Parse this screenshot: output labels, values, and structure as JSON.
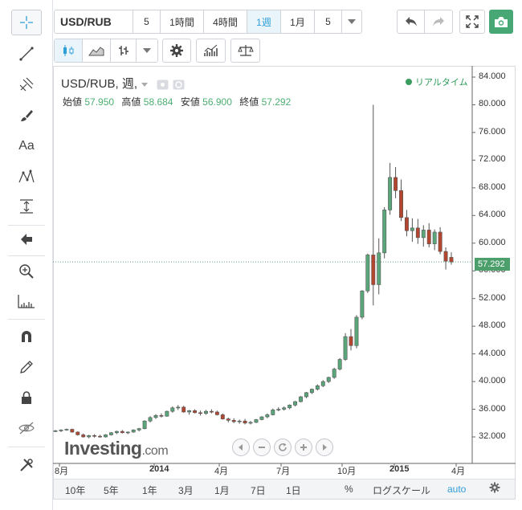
{
  "toolbar": {
    "symbol": "USD/RUB",
    "intervals": [
      "5",
      "1時間",
      "4時間",
      "1週",
      "1月",
      "5"
    ],
    "selected_interval": "1週"
  },
  "legend": {
    "title": "USD/RUB, 週,",
    "open_label": "始値",
    "open": "57.950",
    "high_label": "高値",
    "high": "58.684",
    "low_label": "安値",
    "low": "56.900",
    "close_label": "終値",
    "close": "57.292",
    "realtime": "リアルタイム"
  },
  "price_axis": [
    "84.000",
    "80.000",
    "76.000",
    "72.000",
    "68.000",
    "64.000",
    "60.000",
    "56.000",
    "52.000",
    "48.000",
    "44.000",
    "40.000",
    "36.000",
    "32.000"
  ],
  "last_price": "57.292",
  "time_axis": [
    {
      "label": "8月",
      "bold": false
    },
    {
      "label": "2014",
      "bold": true
    },
    {
      "label": "4月",
      "bold": false
    },
    {
      "label": "7月",
      "bold": false
    },
    {
      "label": "10月",
      "bold": false
    },
    {
      "label": "2015",
      "bold": true
    },
    {
      "label": "4月",
      "bold": false
    }
  ],
  "bottom_bar": {
    "ranges": [
      "10年",
      "5年",
      "1年",
      "3月",
      "1月",
      "7日",
      "1日"
    ],
    "percent": "%",
    "log_scale": "ログスケール",
    "auto": "auto"
  },
  "watermark": {
    "brand": "Investing",
    "suffix": ".com"
  },
  "colors": {
    "up": "#5aa67b",
    "down": "#b4452f",
    "accent": "#2e9fd8"
  },
  "chart_data": {
    "type": "candlestick",
    "title": "USD/RUB, 週,",
    "ylim": [
      30.0,
      86.0
    ],
    "y_ticks": [
      32,
      36,
      40,
      44,
      48,
      52,
      56,
      60,
      64,
      68,
      72,
      76,
      80,
      84
    ],
    "x_ticks": [
      "8月",
      "2014",
      "4月",
      "7月",
      "10月",
      "2015",
      "4月"
    ],
    "candles": [
      [
        32.8,
        33.0,
        32.7,
        32.9
      ],
      [
        32.9,
        33.1,
        32.7,
        33.0
      ],
      [
        33.0,
        33.2,
        32.9,
        33.1
      ],
      [
        33.1,
        33.2,
        32.6,
        32.7
      ],
      [
        32.7,
        32.8,
        32.2,
        32.3
      ],
      [
        32.3,
        32.5,
        31.9,
        32.0
      ],
      [
        32.0,
        32.3,
        31.8,
        32.2
      ],
      [
        32.2,
        32.4,
        31.9,
        32.1
      ],
      [
        32.1,
        32.3,
        31.9,
        32.0
      ],
      [
        32.0,
        32.4,
        31.9,
        32.3
      ],
      [
        32.3,
        32.7,
        32.2,
        32.6
      ],
      [
        32.6,
        32.9,
        32.4,
        32.8
      ],
      [
        32.8,
        33.0,
        32.5,
        32.6
      ],
      [
        32.6,
        32.8,
        32.4,
        32.7
      ],
      [
        32.7,
        33.1,
        32.6,
        33.0
      ],
      [
        33.0,
        33.3,
        32.8,
        33.2
      ],
      [
        33.2,
        34.4,
        33.1,
        34.3
      ],
      [
        34.3,
        35.0,
        34.1,
        34.8
      ],
      [
        34.8,
        35.3,
        34.6,
        35.1
      ],
      [
        35.1,
        35.4,
        34.8,
        35.0
      ],
      [
        35.0,
        35.8,
        34.9,
        35.7
      ],
      [
        35.7,
        36.4,
        35.5,
        36.2
      ],
      [
        36.2,
        36.6,
        35.9,
        36.3
      ],
      [
        36.3,
        36.5,
        35.5,
        35.6
      ],
      [
        35.6,
        35.9,
        35.2,
        35.8
      ],
      [
        35.8,
        36.0,
        35.4,
        35.5
      ],
      [
        35.5,
        35.8,
        35.1,
        35.4
      ],
      [
        35.4,
        35.9,
        35.2,
        35.7
      ],
      [
        35.7,
        36.0,
        35.4,
        35.6
      ],
      [
        35.6,
        35.8,
        35.1,
        35.2
      ],
      [
        35.2,
        35.4,
        34.5,
        34.6
      ],
      [
        34.6,
        34.8,
        34.1,
        34.4
      ],
      [
        34.4,
        34.7,
        34.0,
        34.2
      ],
      [
        34.2,
        34.5,
        33.9,
        34.3
      ],
      [
        34.3,
        34.6,
        33.8,
        34.0
      ],
      [
        34.0,
        34.3,
        33.8,
        34.1
      ],
      [
        34.1,
        34.6,
        34.0,
        34.5
      ],
      [
        34.5,
        35.0,
        34.4,
        34.9
      ],
      [
        34.9,
        35.4,
        34.7,
        35.2
      ],
      [
        35.2,
        36.1,
        35.1,
        35.9
      ],
      [
        35.9,
        36.3,
        35.7,
        36.0
      ],
      [
        36.0,
        36.4,
        35.8,
        36.2
      ],
      [
        36.2,
        36.7,
        36.0,
        36.6
      ],
      [
        36.6,
        37.2,
        36.4,
        37.1
      ],
      [
        37.1,
        37.9,
        37.0,
        37.8
      ],
      [
        37.8,
        38.5,
        37.6,
        38.4
      ],
      [
        38.4,
        39.0,
        38.2,
        38.9
      ],
      [
        38.9,
        39.6,
        38.7,
        39.4
      ],
      [
        39.4,
        40.2,
        39.2,
        40.0
      ],
      [
        40.0,
        40.7,
        39.8,
        40.6
      ],
      [
        40.6,
        42.0,
        40.4,
        41.8
      ],
      [
        41.8,
        43.4,
        41.6,
        43.2
      ],
      [
        43.2,
        47.0,
        43.0,
        46.5
      ],
      [
        46.5,
        47.6,
        44.5,
        45.2
      ],
      [
        45.2,
        49.6,
        44.8,
        49.3
      ],
      [
        49.3,
        53.2,
        49.0,
        53.1
      ],
      [
        53.1,
        58.5,
        52.8,
        58.3
      ],
      [
        58.3,
        80.0,
        51.0,
        54.0
      ],
      [
        54.0,
        60.7,
        52.6,
        58.6
      ],
      [
        58.6,
        65.2,
        57.8,
        64.8
      ],
      [
        64.8,
        71.6,
        64.1,
        69.5
      ],
      [
        69.5,
        71.0,
        66.5,
        67.6
      ],
      [
        67.6,
        69.2,
        63.2,
        63.7
      ],
      [
        63.7,
        64.8,
        61.0,
        61.8
      ],
      [
        61.8,
        63.6,
        60.2,
        62.2
      ],
      [
        62.2,
        63.5,
        59.9,
        60.8
      ],
      [
        60.8,
        62.6,
        59.5,
        61.9
      ],
      [
        61.9,
        62.9,
        59.4,
        59.9
      ],
      [
        59.9,
        62.0,
        59.0,
        61.6
      ],
      [
        61.6,
        62.3,
        58.4,
        58.8
      ],
      [
        58.8,
        59.4,
        56.2,
        57.4
      ],
      [
        57.95,
        58.684,
        56.9,
        57.292
      ]
    ]
  }
}
